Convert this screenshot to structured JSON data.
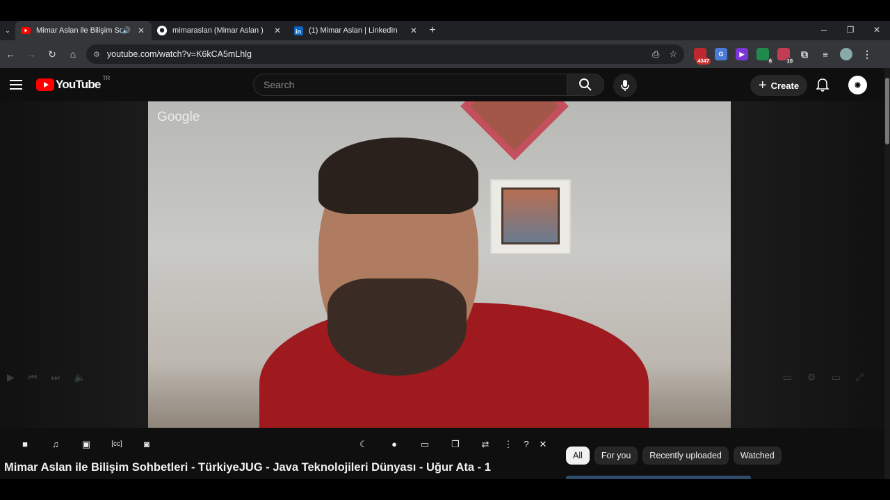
{
  "browser": {
    "tabs": [
      {
        "title": "Mimar Aslan ile Bilişim Soht",
        "active": true,
        "icon": "youtube-icon",
        "audio": true
      },
      {
        "title": "mimaraslan (Mimar Aslan )",
        "active": false,
        "icon": "github-icon"
      },
      {
        "title": "(1) Mimar Aslan | LinkedIn",
        "active": false,
        "icon": "linkedin-icon"
      }
    ],
    "url": "youtube.com/watch?v=K6kCA5mLhlg",
    "extensions": [
      {
        "name": "extension-red-icon",
        "badge": "4347",
        "color": "#c0282f"
      },
      {
        "name": "translate-icon",
        "badge": "",
        "color": "#4a7bd8"
      },
      {
        "name": "media-extension-icon",
        "badge": "",
        "color": "#7b36d9"
      },
      {
        "name": "extension-green-icon",
        "badge": "6",
        "color": "#1f8a4c"
      },
      {
        "name": "extension-pink-icon",
        "badge": "10",
        "color": "#c23c56"
      }
    ]
  },
  "youtube": {
    "logo_text": "YouTube",
    "country_code": "TR",
    "search_placeholder": "Search",
    "create_label": "Create",
    "video_title": "Mimar Aslan ile Bilişim Sohbetleri - TürkiyeJUG - Java Teknolojileri Dünyası - Uğur Ata - 1",
    "watermark": "Google",
    "chips": [
      {
        "label": "All",
        "active": true
      },
      {
        "label": "For you",
        "active": false
      },
      {
        "label": "Recently uploaded",
        "active": false
      },
      {
        "label": "Watched",
        "active": false
      }
    ],
    "accent_color": "#ff0000"
  },
  "extension_bar": {
    "icons": [
      "video-camera-icon",
      "music-note-icon",
      "image-icon",
      "captions-icon",
      "camera-icon",
      "moon-icon",
      "lightbulb-icon",
      "picture-in-picture-icon",
      "copy-icon",
      "loop-icon",
      "more-icon",
      "help-icon",
      "close-icon"
    ]
  }
}
